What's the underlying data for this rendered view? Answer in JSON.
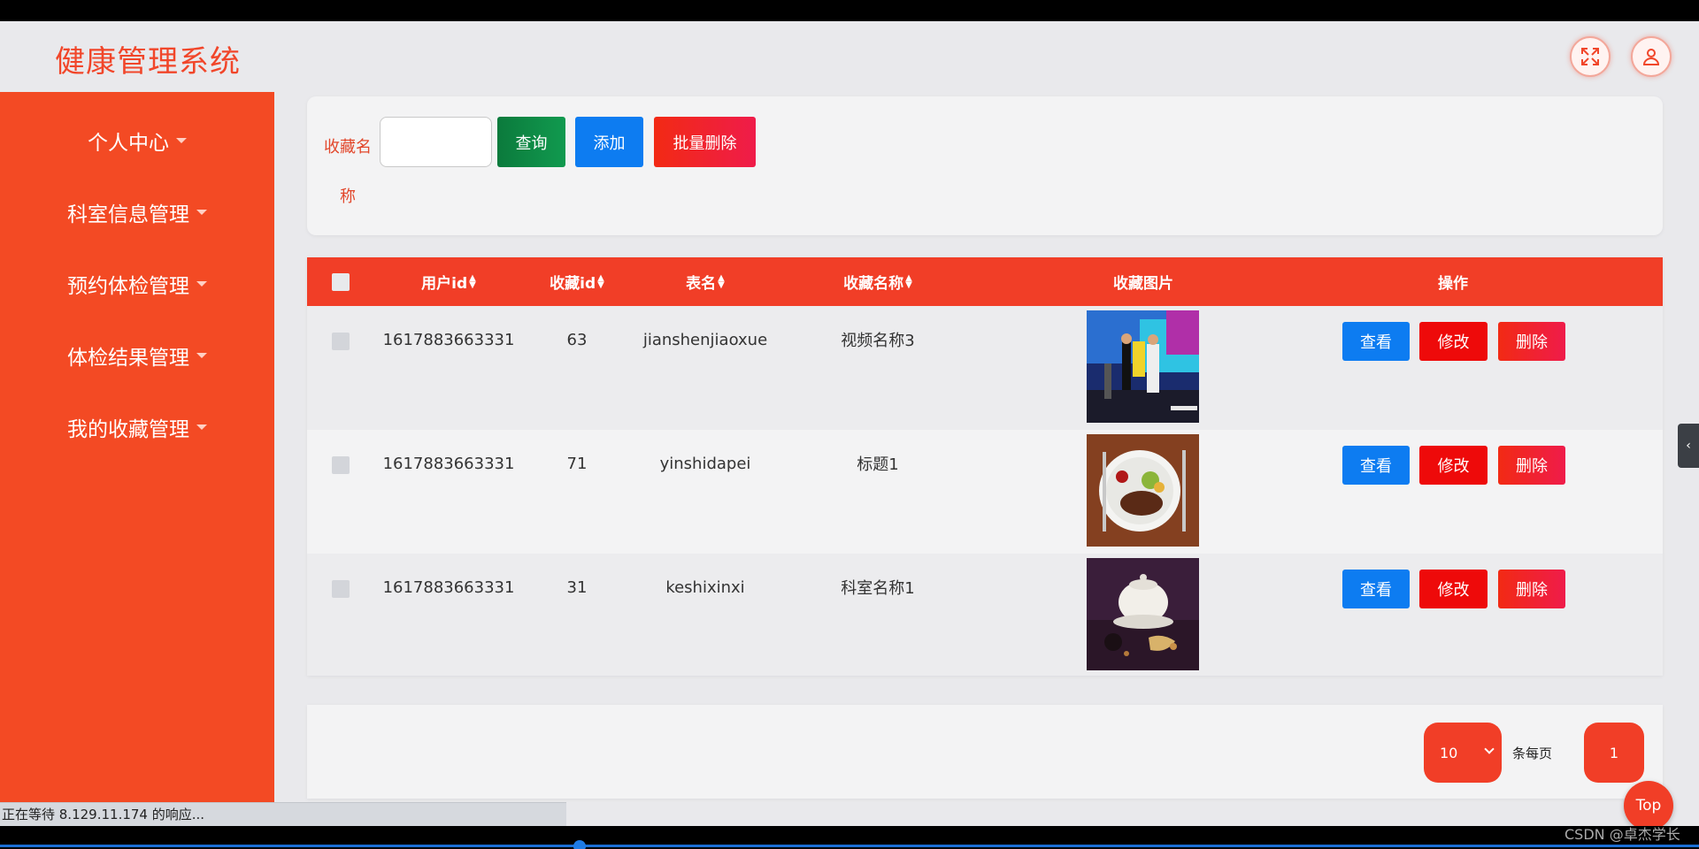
{
  "header": {
    "title": "健康管理系统",
    "fullscreen_icon": "expand-icon",
    "user_icon": "user-icon"
  },
  "sidebar": {
    "items": [
      {
        "label": "个人中心"
      },
      {
        "label": "科室信息管理"
      },
      {
        "label": "预约体检管理"
      },
      {
        "label": "体检结果管理"
      },
      {
        "label": "我的收藏管理"
      }
    ]
  },
  "search": {
    "label": "收藏名称",
    "placeholder": "",
    "query_label": "查询",
    "add_label": "添加",
    "batch_delete_label": "批量删除"
  },
  "table": {
    "columns": [
      "用户id",
      "收藏id",
      "表名",
      "收藏名称",
      "收藏图片",
      "操作"
    ],
    "rows": [
      {
        "user_id": "1617883663331",
        "fav_id": "63",
        "table_name": "jianshenjiaoxue",
        "fav_name": "视频名称3"
      },
      {
        "user_id": "1617883663331",
        "fav_id": "71",
        "table_name": "yinshidapei",
        "fav_name": "标题1"
      },
      {
        "user_id": "1617883663331",
        "fav_id": "31",
        "table_name": "keshixinxi",
        "fav_name": "科室名称1"
      }
    ],
    "view_label": "查看",
    "edit_label": "修改",
    "delete_label": "删除"
  },
  "pagination": {
    "page_size": "10",
    "per_page_label": "条每页",
    "current_page": "1"
  },
  "top_button": "Top",
  "status_bar": "正在等待 8.129.11.174 的响应...",
  "watermark": "CSDN @卓杰学长",
  "colors": {
    "primary": "#f34a24",
    "header_red": "#f13e27",
    "blue": "#0d7cf1",
    "green": "#0b7a3c"
  }
}
